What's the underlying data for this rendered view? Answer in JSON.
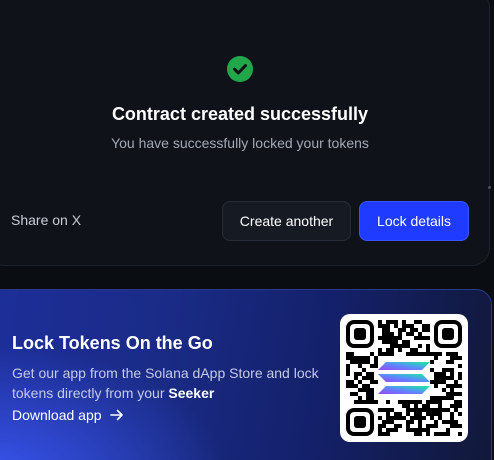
{
  "success": {
    "title": "Contract created successfully",
    "subtitle": "You have successfully locked your tokens",
    "share_label": "Share on X",
    "create_another_label": "Create another",
    "lock_details_label": "Lock details",
    "accent_color": "#1f3bff",
    "check_color": "#22a64a",
    "check_icon": "check-circle-icon"
  },
  "promo": {
    "title": "Lock Tokens On the Go",
    "desc_prefix": "Get our app from the Solana dApp Store and lock tokens directly from your ",
    "desc_bold": "Seeker",
    "download_label": "Download app",
    "arrow_icon": "arrow-right-icon",
    "qr_icon": "qr-code",
    "logo_icon": "solana-logo-icon"
  }
}
